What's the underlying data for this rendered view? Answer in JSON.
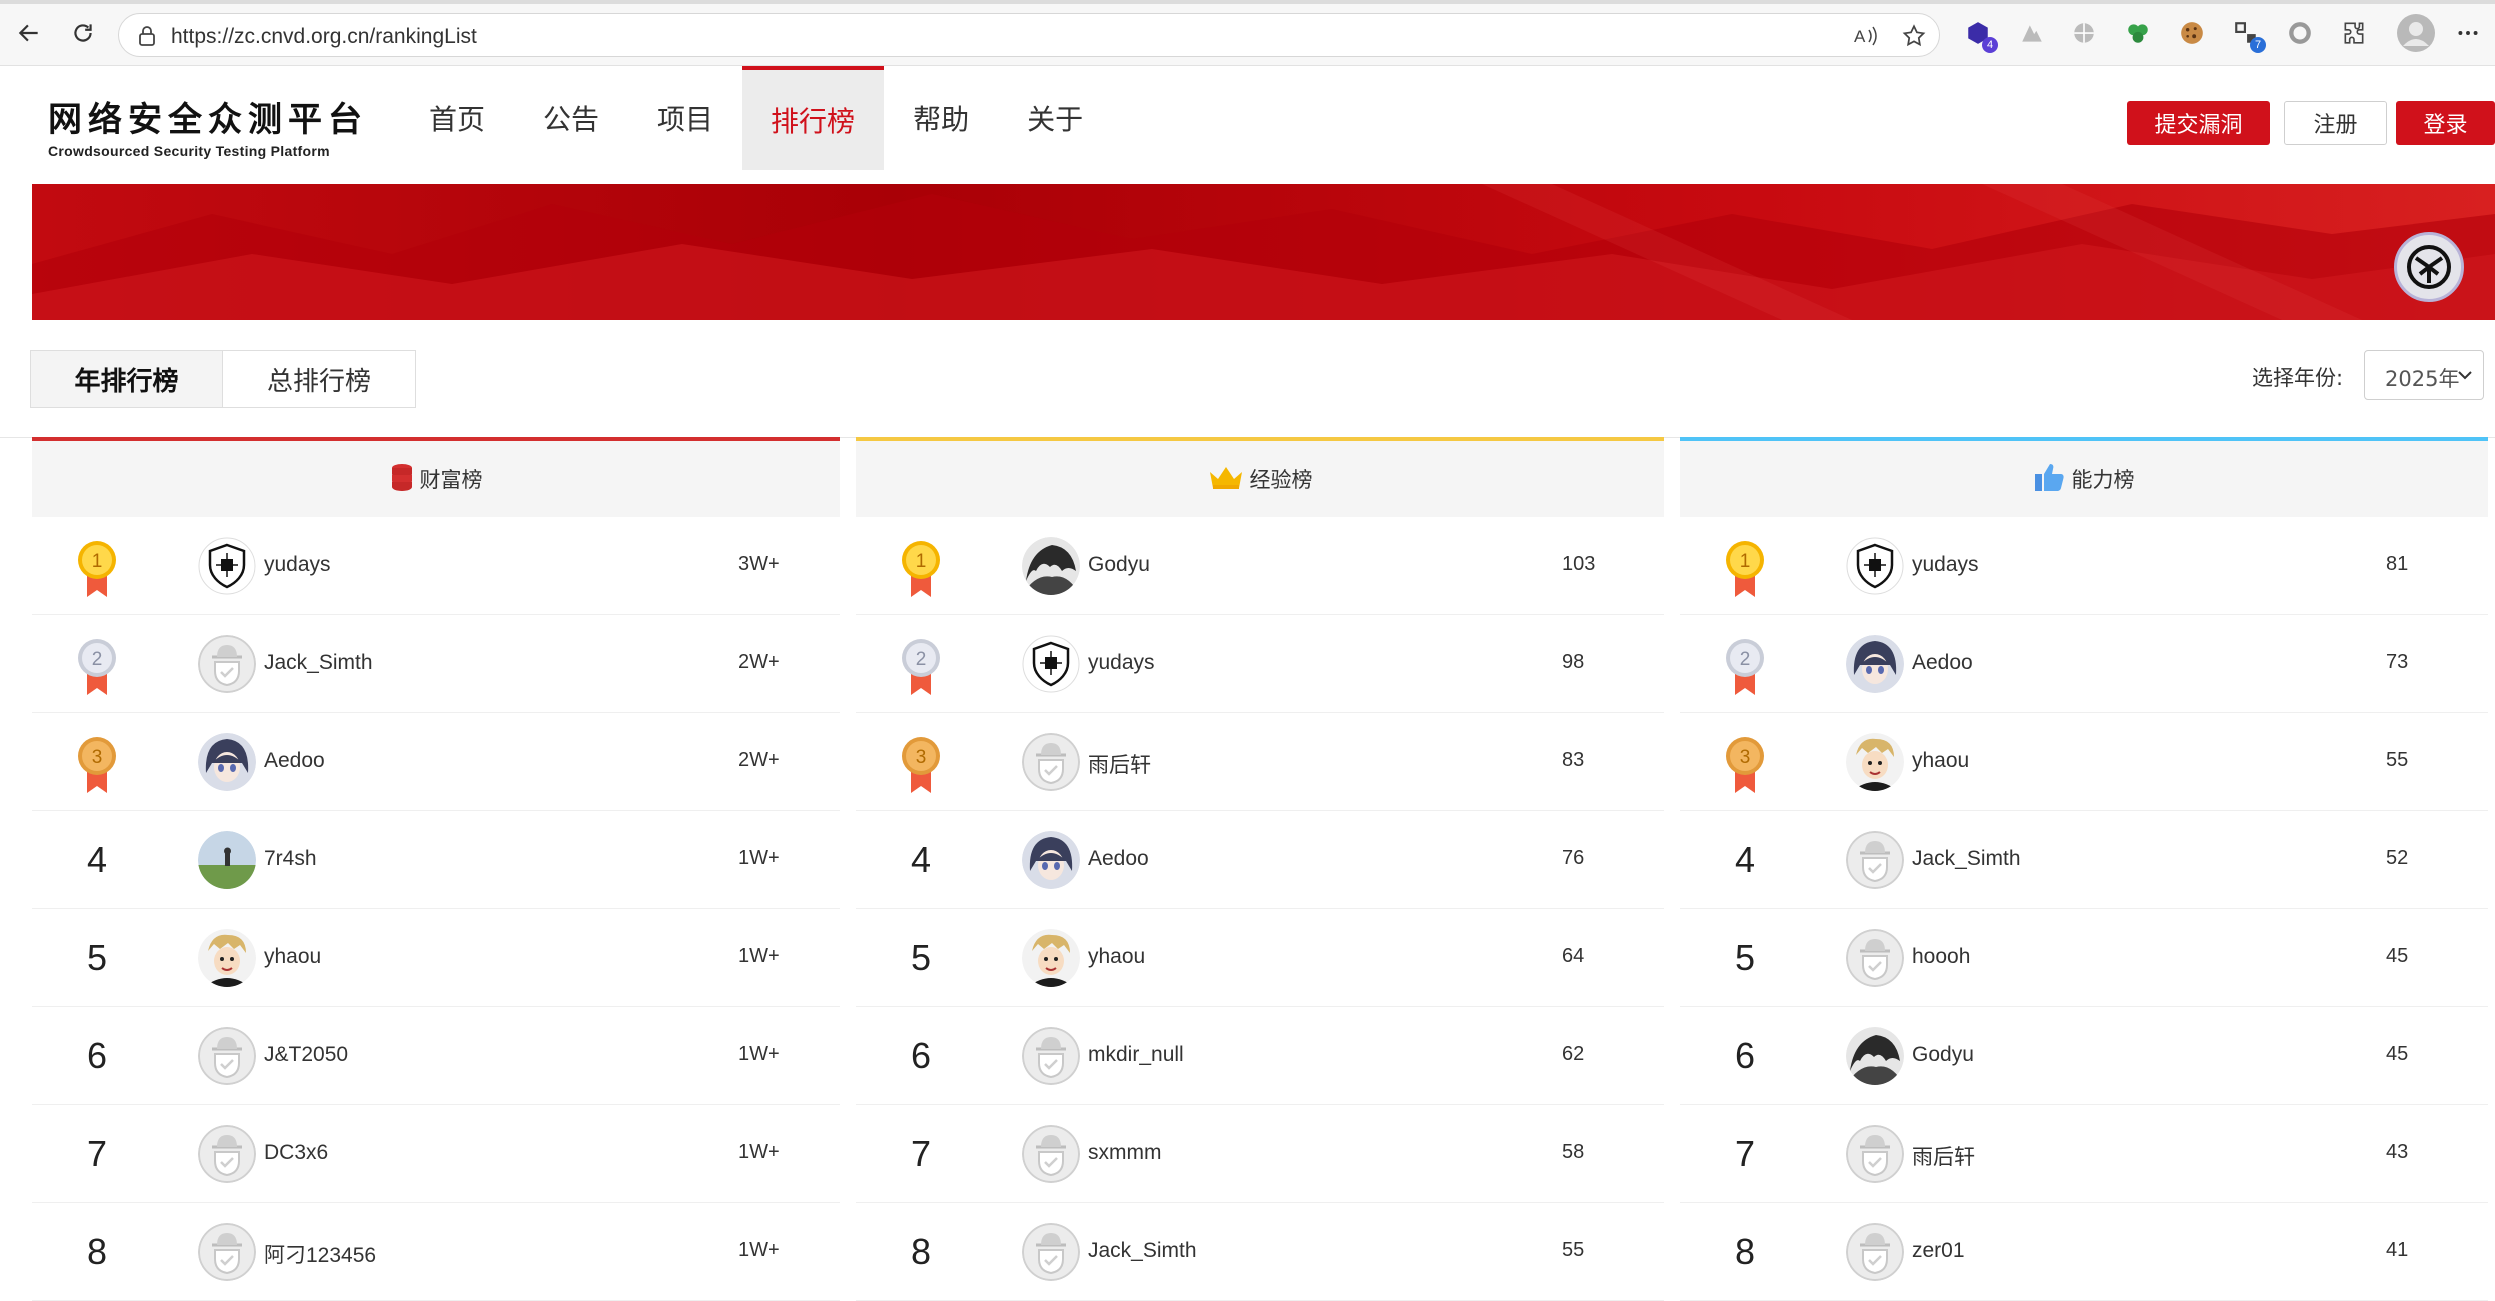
{
  "browser": {
    "url": "https://zc.cnvd.org.cn/rankingList",
    "ext_badges": [
      "4",
      "7"
    ]
  },
  "header": {
    "logo_cn": "网络安全众测平台",
    "logo_en": "Crowdsourced Security Testing Platform",
    "nav": [
      "首页",
      "公告",
      "项目",
      "排行榜",
      "帮助",
      "关于"
    ],
    "active_nav": "排行榜",
    "submit_label": "提交漏洞",
    "register_label": "注册",
    "login_label": "登录"
  },
  "colors": {
    "brand_red": "#d0111b",
    "wealth_accent": "#d32f2f",
    "exp_accent": "#f5c842",
    "ability_accent": "#4fc3f7"
  },
  "tabs": {
    "yearly": "年排行榜",
    "total": "总排行榜",
    "year_label": "选择年份:",
    "year_value": "2025年"
  },
  "boards": [
    {
      "title": "财富榜",
      "icon": "coin-stack-icon",
      "rows": [
        {
          "rank": "1",
          "name": "yudays",
          "score": "3W+",
          "avatar": "shield"
        },
        {
          "rank": "2",
          "name": "Jack_Simth",
          "score": "2W+",
          "avatar": "default"
        },
        {
          "rank": "3",
          "name": "Aedoo",
          "score": "2W+",
          "avatar": "anime"
        },
        {
          "rank": "4",
          "name": "7r4sh",
          "score": "1W+",
          "avatar": "landscape"
        },
        {
          "rank": "5",
          "name": "yhaou",
          "score": "1W+",
          "avatar": "cartoon"
        },
        {
          "rank": "6",
          "name": "J&T2050",
          "score": "1W+",
          "avatar": "default"
        },
        {
          "rank": "7",
          "name": "DC3x6",
          "score": "1W+",
          "avatar": "default"
        },
        {
          "rank": "8",
          "name": "阿刁123456",
          "score": "1W+",
          "avatar": "default"
        }
      ]
    },
    {
      "title": "经验榜",
      "icon": "crown-icon",
      "rows": [
        {
          "rank": "1",
          "name": "Godyu",
          "score": "103",
          "avatar": "dark"
        },
        {
          "rank": "2",
          "name": "yudays",
          "score": "98",
          "avatar": "shield"
        },
        {
          "rank": "3",
          "name": "雨后轩",
          "score": "83",
          "avatar": "default"
        },
        {
          "rank": "4",
          "name": "Aedoo",
          "score": "76",
          "avatar": "anime"
        },
        {
          "rank": "5",
          "name": "yhaou",
          "score": "64",
          "avatar": "cartoon"
        },
        {
          "rank": "6",
          "name": "mkdir_null",
          "score": "62",
          "avatar": "default"
        },
        {
          "rank": "7",
          "name": "sxmmm",
          "score": "58",
          "avatar": "default"
        },
        {
          "rank": "8",
          "name": "Jack_Simth",
          "score": "55",
          "avatar": "default"
        }
      ]
    },
    {
      "title": "能力榜",
      "icon": "thumbs-up-icon",
      "rows": [
        {
          "rank": "1",
          "name": "yudays",
          "score": "81",
          "avatar": "shield"
        },
        {
          "rank": "2",
          "name": "Aedoo",
          "score": "73",
          "avatar": "anime"
        },
        {
          "rank": "3",
          "name": "yhaou",
          "score": "55",
          "avatar": "cartoon"
        },
        {
          "rank": "4",
          "name": "Jack_Simth",
          "score": "52",
          "avatar": "default"
        },
        {
          "rank": "5",
          "name": "hoooh",
          "score": "45",
          "avatar": "default"
        },
        {
          "rank": "6",
          "name": "Godyu",
          "score": "45",
          "avatar": "dark"
        },
        {
          "rank": "7",
          "name": "雨后轩",
          "score": "43",
          "avatar": "default"
        },
        {
          "rank": "8",
          "name": "zer01",
          "score": "41",
          "avatar": "default"
        }
      ]
    }
  ]
}
